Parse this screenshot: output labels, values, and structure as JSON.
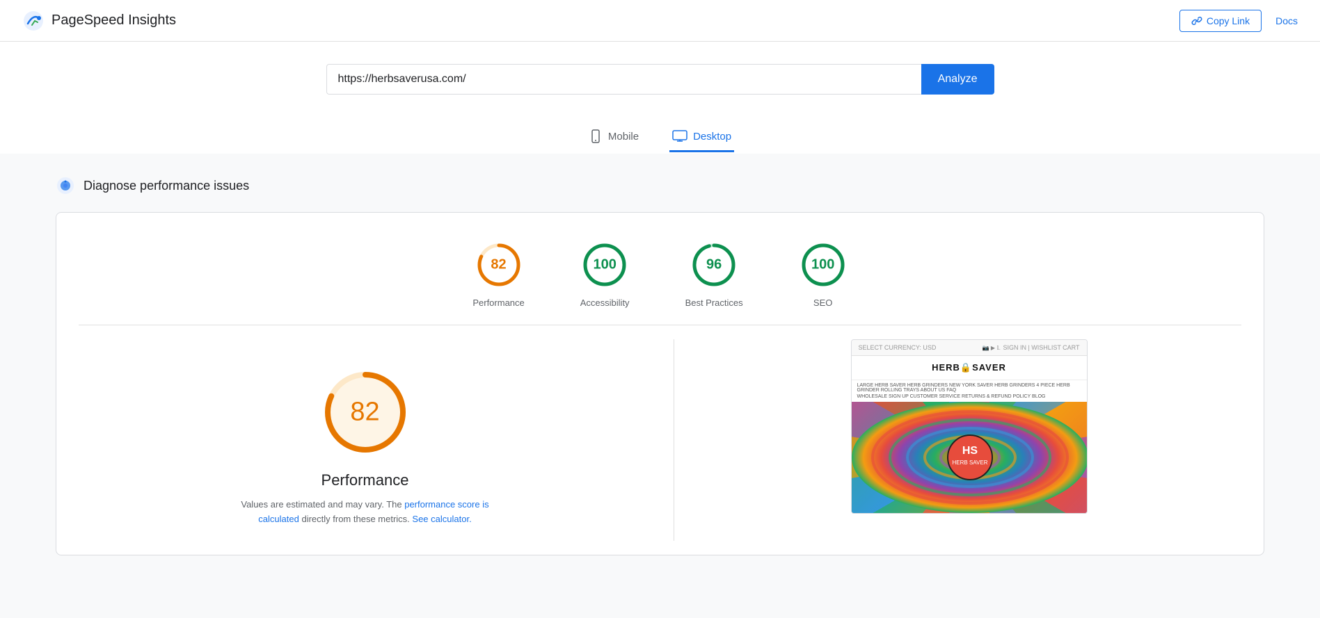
{
  "header": {
    "logo_text": "PageSpeed Insights",
    "copy_link_label": "Copy Link",
    "docs_label": "Docs"
  },
  "search": {
    "url_value": "https://herbsaverusa.com/",
    "analyze_label": "Analyze"
  },
  "device_tabs": [
    {
      "id": "mobile",
      "label": "Mobile",
      "active": false
    },
    {
      "id": "desktop",
      "label": "Desktop",
      "active": true
    }
  ],
  "diagnose": {
    "title": "Diagnose performance issues"
  },
  "scores": [
    {
      "id": "performance",
      "value": 82,
      "label": "Performance",
      "color": "#e67700",
      "track_color": "#fde8c8",
      "green": false
    },
    {
      "id": "accessibility",
      "value": 100,
      "label": "Accessibility",
      "color": "#0d904f",
      "track_color": "#c8f0dd",
      "green": true
    },
    {
      "id": "best_practices",
      "value": 96,
      "label": "Best Practices",
      "color": "#0d904f",
      "track_color": "#c8f0dd",
      "green": true
    },
    {
      "id": "seo",
      "value": 100,
      "label": "SEO",
      "color": "#0d904f",
      "track_color": "#c8f0dd",
      "green": true
    }
  ],
  "performance_panel": {
    "score": 82,
    "title": "Performance",
    "desc_text": "Values are estimated and may vary. The ",
    "link1_label": "performance score is calculated",
    "desc_middle": " directly from these metrics. ",
    "link2_label": "See calculator.",
    "score_color": "#e67700",
    "track_color": "#fde8c8"
  },
  "preview": {
    "header_left": "SELECT CURRENCY: USD",
    "header_right": "SIGN IN | WISHLIST  CART",
    "logo_text": "HERB🔒SAVER",
    "nav_text": "LARGE HERB SAVER  HERB GRINDERS  NEW YORK SAVER HERB GRINDERS  4 PIECE HERB GRINDER  ROLLING TRAYS  ABOUT US  FAQ",
    "sub_nav": "WHOLESALE SIGN UP    CUSTOMER SERVICE    RETURNS & REFUND POLICY    BLOG"
  }
}
